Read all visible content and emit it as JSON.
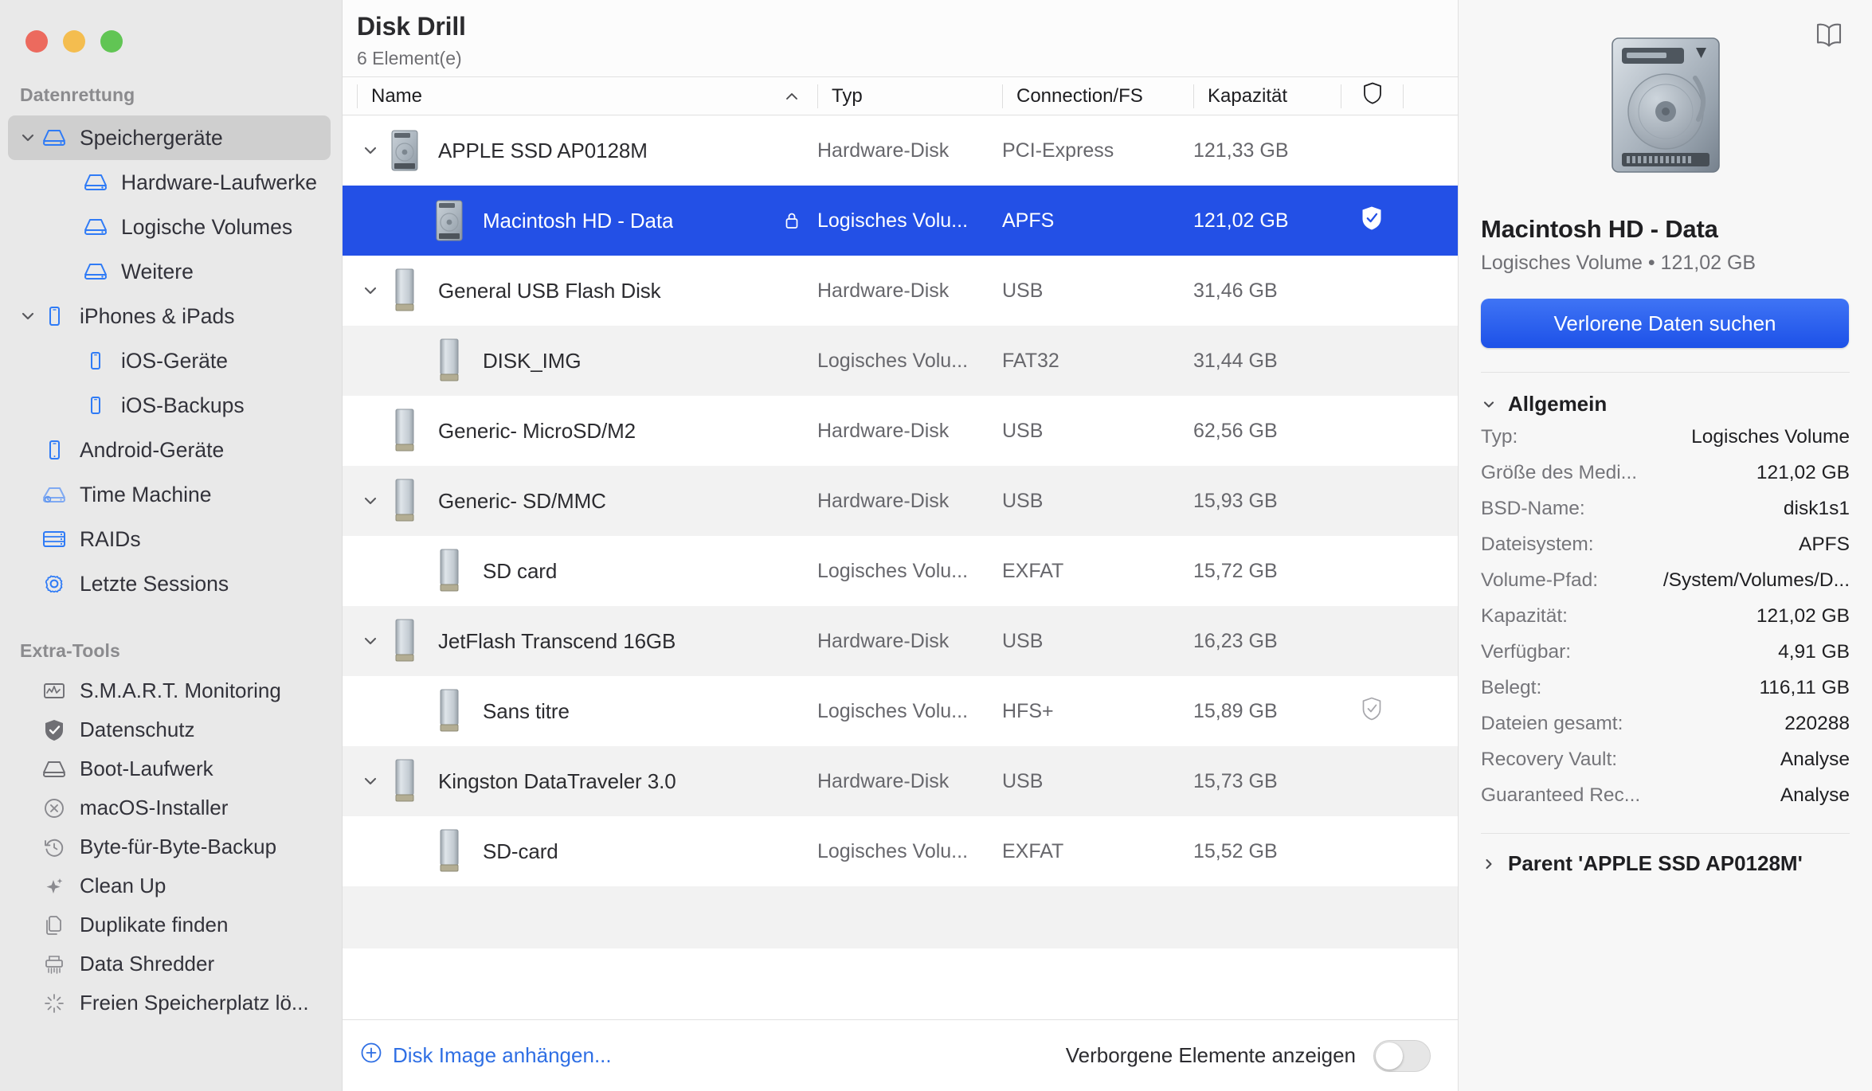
{
  "window": {
    "traffic_lights": [
      "close",
      "minimize",
      "zoom"
    ],
    "colors": {
      "close": "#ec6a5e",
      "minimize": "#f4bd4f",
      "zoom": "#61c554",
      "accent": "#2350e6",
      "selection": "#2350e6",
      "link": "#2f6fe4"
    }
  },
  "sidebar": {
    "sections": [
      {
        "title": "Datenrettung",
        "items": [
          {
            "label": "Speichergeräte",
            "icon": "hard-drive-icon",
            "level": 1,
            "chevron": "down",
            "selected": true
          },
          {
            "label": "Hardware-Laufwerke",
            "icon": "hard-drive-icon",
            "level": 2,
            "chevron": "none",
            "selected": false
          },
          {
            "label": "Logische Volumes",
            "icon": "hard-drive-icon",
            "level": 2,
            "chevron": "none",
            "selected": false
          },
          {
            "label": "Weitere",
            "icon": "hard-drive-icon",
            "level": 2,
            "chevron": "none",
            "selected": false
          },
          {
            "label": "iPhones & iPads",
            "icon": "phone-icon",
            "level": 1,
            "chevron": "down",
            "selected": false
          },
          {
            "label": "iOS-Geräte",
            "icon": "phone-icon",
            "level": 2,
            "chevron": "none",
            "selected": false
          },
          {
            "label": "iOS-Backups",
            "icon": "phone-icon",
            "level": 2,
            "chevron": "none",
            "selected": false
          },
          {
            "label": "Android-Geräte",
            "icon": "phone-icon",
            "level": 1,
            "chevron": "none",
            "selected": false
          },
          {
            "label": "Time Machine",
            "icon": "time-machine-icon",
            "level": 1,
            "chevron": "none",
            "selected": false
          },
          {
            "label": "RAIDs",
            "icon": "raid-icon",
            "level": 1,
            "chevron": "none",
            "selected": false
          },
          {
            "label": "Letzte Sessions",
            "icon": "gear-icon",
            "level": 1,
            "chevron": "none",
            "selected": false
          }
        ]
      },
      {
        "title": "Extra-Tools",
        "items": [
          {
            "label": "S.M.A.R.T. Monitoring",
            "icon": "smart-monitor-icon"
          },
          {
            "label": "Datenschutz",
            "icon": "shield-check-icon"
          },
          {
            "label": "Boot-Laufwerk",
            "icon": "hard-drive-icon"
          },
          {
            "label": "macOS-Installer",
            "icon": "circle-x-icon"
          },
          {
            "label": "Byte-für-Byte-Backup",
            "icon": "clock-rewind-icon"
          },
          {
            "label": "Clean Up",
            "icon": "sparkle-icon"
          },
          {
            "label": "Duplikate finden",
            "icon": "duplicate-files-icon"
          },
          {
            "label": "Data Shredder",
            "icon": "shredder-icon"
          },
          {
            "label": "Freien Speicherplatz lö...",
            "icon": "erase-free-space-icon"
          }
        ]
      }
    ]
  },
  "header": {
    "title": "Disk Drill",
    "subtitle": "6 Element(e)",
    "book_icon": "book-icon"
  },
  "table": {
    "columns": [
      {
        "key": "name",
        "label": "Name",
        "sorted": "asc",
        "sort_caret": "chevron-up-icon"
      },
      {
        "key": "typ",
        "label": "Typ"
      },
      {
        "key": "conn",
        "label": "Connection/FS"
      },
      {
        "key": "kap",
        "label": "Kapazität"
      },
      {
        "key": "shield",
        "label": "",
        "icon": "shield-icon"
      }
    ],
    "rows": [
      {
        "name": "APPLE SSD AP0128M",
        "typ": "Hardware-Disk",
        "conn": "PCI-Express",
        "kap": "121,33 GB",
        "chevron": "down",
        "child": false,
        "selected": false,
        "alt": false,
        "icon": "internal-disk-icon",
        "lock": false,
        "shield": "none"
      },
      {
        "name": "Macintosh HD - Data",
        "typ": "Logisches Volu...",
        "conn": "APFS",
        "kap": "121,02 GB",
        "chevron": "none",
        "child": true,
        "selected": true,
        "alt": false,
        "icon": "internal-disk-icon",
        "lock": true,
        "shield": "checked"
      },
      {
        "name": "General USB Flash Disk",
        "typ": "Hardware-Disk",
        "conn": "USB",
        "kap": "31,46 GB",
        "chevron": "down",
        "child": false,
        "selected": false,
        "alt": false,
        "icon": "usb-stick-icon",
        "lock": false,
        "shield": "none"
      },
      {
        "name": "DISK_IMG",
        "typ": "Logisches Volu...",
        "conn": "FAT32",
        "kap": "31,44 GB",
        "chevron": "none",
        "child": true,
        "selected": false,
        "alt": true,
        "icon": "usb-stick-icon",
        "lock": false,
        "shield": "none"
      },
      {
        "name": "Generic- MicroSD/M2",
        "typ": "Hardware-Disk",
        "conn": "USB",
        "kap": "62,56 GB",
        "chevron": "none",
        "child": false,
        "selected": false,
        "alt": false,
        "icon": "usb-stick-icon",
        "lock": false,
        "shield": "none"
      },
      {
        "name": "Generic- SD/MMC",
        "typ": "Hardware-Disk",
        "conn": "USB",
        "kap": "15,93 GB",
        "chevron": "down",
        "child": false,
        "selected": false,
        "alt": true,
        "icon": "usb-stick-icon",
        "lock": false,
        "shield": "none"
      },
      {
        "name": "SD card",
        "typ": "Logisches Volu...",
        "conn": "EXFAT",
        "kap": "15,72 GB",
        "chevron": "none",
        "child": true,
        "selected": false,
        "alt": false,
        "icon": "usb-stick-icon",
        "lock": false,
        "shield": "none"
      },
      {
        "name": "JetFlash Transcend 16GB",
        "typ": "Hardware-Disk",
        "conn": "USB",
        "kap": "16,23 GB",
        "chevron": "down",
        "child": false,
        "selected": false,
        "alt": true,
        "icon": "usb-stick-icon",
        "lock": false,
        "shield": "none"
      },
      {
        "name": "Sans titre",
        "typ": "Logisches Volu...",
        "conn": "HFS+",
        "kap": "15,89 GB",
        "chevron": "none",
        "child": true,
        "selected": false,
        "alt": false,
        "icon": "usb-stick-icon",
        "lock": false,
        "shield": "outline"
      },
      {
        "name": "Kingston DataTraveler 3.0",
        "typ": "Hardware-Disk",
        "conn": "USB",
        "kap": "15,73 GB",
        "chevron": "down",
        "child": false,
        "selected": false,
        "alt": true,
        "icon": "usb-stick-icon",
        "lock": false,
        "shield": "none"
      },
      {
        "name": "SD-card",
        "typ": "Logisches Volu...",
        "conn": "EXFAT",
        "kap": "15,52 GB",
        "chevron": "none",
        "child": true,
        "selected": false,
        "alt": false,
        "icon": "usb-stick-icon",
        "lock": false,
        "shield": "none"
      }
    ]
  },
  "bottom_bar": {
    "attach_label": "Disk Image anhängen...",
    "attach_icon": "plus-circle-icon",
    "hidden_items_label": "Verborgene Elemente anzeigen",
    "hidden_items_on": false
  },
  "detail": {
    "artwork_icon": "internal-disk-large-icon",
    "title": "Macintosh HD - Data",
    "subtitle": "Logisches Volume • 121,02 GB",
    "primary_button": "Verlorene Daten suchen",
    "general_section": {
      "label": "Allgemein",
      "expanded": true,
      "rows": [
        {
          "key": "Typ:",
          "value": "Logisches Volume"
        },
        {
          "key": "Größe des Medi...",
          "value": "121,02 GB"
        },
        {
          "key": "BSD-Name:",
          "value": "disk1s1"
        },
        {
          "key": "Dateisystem:",
          "value": "APFS"
        },
        {
          "key": "Volume-Pfad:",
          "value": "/System/Volumes/D..."
        },
        {
          "key": "Kapazität:",
          "value": "121,02 GB"
        },
        {
          "key": "Verfügbar:",
          "value": "4,91 GB"
        },
        {
          "key": "Belegt:",
          "value": "116,11 GB"
        },
        {
          "key": "Dateien gesamt:",
          "value": "220288"
        },
        {
          "key": "Recovery Vault:",
          "value": "Analyse"
        },
        {
          "key": "Guaranteed Rec...",
          "value": "Analyse"
        }
      ]
    },
    "parent_section": {
      "label": "Parent 'APPLE SSD AP0128M'",
      "expanded": false
    }
  }
}
